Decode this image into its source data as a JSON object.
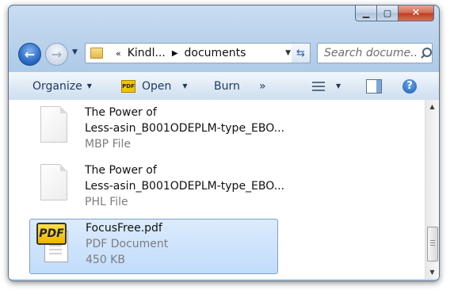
{
  "window": {
    "caption": {
      "minimize": "▁",
      "maximize": "▢",
      "close": "✕"
    }
  },
  "nav": {
    "back_glyph": "←",
    "forward_glyph": "→",
    "history_glyph": "▼"
  },
  "address": {
    "overflow": "«",
    "crumbs": [
      "Kindl...",
      "documents"
    ],
    "separator": "▶",
    "dropdown": "▼",
    "refresh_glyph": "⇆"
  },
  "search": {
    "placeholder": "Search docume..."
  },
  "toolbar": {
    "organize": "Organize",
    "open": "Open",
    "open_icon_text": "PDF",
    "burn": "Burn",
    "more": "»",
    "caret": "▼"
  },
  "files": [
    {
      "name_line1": "The Power of",
      "name_line2": "Less-asin_B001ODEPLM-type_EBO...",
      "type": "MBP File",
      "icon": "generic-document-icon"
    },
    {
      "name_line1": "The Power of",
      "name_line2": "Less-asin_B001ODEPLM-type_EBO...",
      "type": "PHL File",
      "icon": "generic-document-icon"
    },
    {
      "name": "FocusFree.pdf",
      "type": "PDF Document",
      "size": "450 KB",
      "icon_text": "PDF",
      "icon": "pdf-document-icon",
      "selected": true
    }
  ],
  "scrollbar": {
    "up": "▲",
    "down": "▼",
    "position": 0.9
  },
  "colors": {
    "chrome": "#bcd3ec",
    "selection": "#c1dcfc",
    "selection_border": "#7da2ce",
    "close_button": "#c0391f",
    "text_secondary": "#7d7d7d"
  }
}
